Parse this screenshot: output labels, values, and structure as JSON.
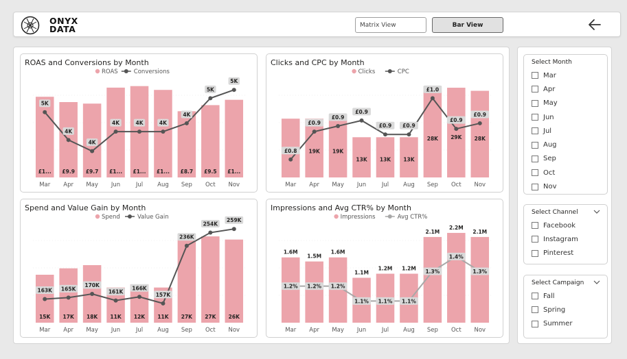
{
  "header": {
    "logo_line1": "ONYX",
    "logo_line2": "DATA",
    "matrix_view_label": "Matrix View",
    "bar_view_label": "Bar View",
    "back_icon": "arrow-left-icon"
  },
  "colors": {
    "bar": "#eca4ab",
    "line": "#555555",
    "line_light": "#a8a8a8",
    "label_bg": "#d9d9d9",
    "gridline": "#e6e6e6"
  },
  "chart_data": [
    {
      "type": "bar",
      "title": "ROAS and Conversions by Month",
      "categories": [
        "Mar",
        "Apr",
        "May",
        "Jun",
        "Jul",
        "Aug",
        "Sep",
        "Oct",
        "Nov"
      ],
      "series": [
        {
          "name": "ROAS",
          "kind": "bar",
          "values": [
            10.6,
            9.9,
            9.7,
            11.8,
            12.0,
            11.5,
            8.7,
            9.5,
            10.2
          ],
          "labels": [
            "£1...",
            "£9.9",
            "£9.7",
            "£1...",
            "£1...",
            "£1...",
            "£8.7",
            "£9.5",
            "£1..."
          ]
        },
        {
          "name": "Conversions",
          "kind": "line",
          "values": [
            4700,
            3700,
            3300,
            4000,
            4000,
            4000,
            4300,
            5200,
            5500
          ],
          "labels": [
            "5K",
            "4K",
            "4K",
            "4K",
            "4K",
            "4K",
            "4K",
            "5K",
            "5K"
          ]
        }
      ]
    },
    {
      "type": "bar",
      "title": "Clicks and CPC by Month",
      "categories": [
        "Mar",
        "Apr",
        "May",
        "Jun",
        "Jul",
        "Aug",
        "Sep",
        "Oct",
        "Nov"
      ],
      "series": [
        {
          "name": "Clicks",
          "kind": "bar",
          "values": [
            19000,
            19000,
            19000,
            13000,
            13000,
            13000,
            28000,
            29000,
            28000
          ],
          "labels": [
            "19K",
            "19K",
            "19K",
            "13K",
            "13K",
            "13K",
            "28K",
            "29K",
            "28K"
          ]
        },
        {
          "name": "CPC",
          "kind": "line",
          "values": [
            0.78,
            0.88,
            0.9,
            0.92,
            0.87,
            0.87,
            1.0,
            0.89,
            0.91
          ],
          "labels": [
            "£0.8",
            "£0.9",
            "£0.9",
            "£0.9",
            "£0.9",
            "£0.9",
            "£1.0",
            "£0.9",
            "£0.9"
          ]
        }
      ]
    },
    {
      "type": "bar",
      "title": "Spend and Value Gain by Month",
      "categories": [
        "Mar",
        "Apr",
        "May",
        "Jun",
        "Jul",
        "Aug",
        "Sep",
        "Oct",
        "Nov"
      ],
      "series": [
        {
          "name": "Spend",
          "kind": "bar",
          "values": [
            15000,
            17000,
            18000,
            11000,
            12000,
            11000,
            27000,
            27000,
            26000
          ],
          "labels": [
            "15K",
            "17K",
            "18K",
            "11K",
            "12K",
            "11K",
            "27K",
            "27K",
            "26K"
          ]
        },
        {
          "name": "Value Gain",
          "kind": "line",
          "values": [
            163000,
            165000,
            170000,
            161000,
            166000,
            157000,
            236000,
            254000,
            259000
          ],
          "labels": [
            "163K",
            "165K",
            "170K",
            "161K",
            "166K",
            "157K",
            "236K",
            "254K",
            "259K"
          ]
        }
      ]
    },
    {
      "type": "bar",
      "title": "Impressions and Avg CTR% by Month",
      "categories": [
        "Mar",
        "Apr",
        "May",
        "Jun",
        "Jul",
        "Aug",
        "Sep",
        "Oct",
        "Nov"
      ],
      "series": [
        {
          "name": "Impressions",
          "kind": "bar",
          "values": [
            1600000,
            1500000,
            1600000,
            1100000,
            1200000,
            1200000,
            2100000,
            2200000,
            2100000
          ],
          "labels": [
            "1.6M",
            "1.5M",
            "1.6M",
            "1.1M",
            "1.2M",
            "1.2M",
            "2.1M",
            "2.2M",
            "2.1M"
          ]
        },
        {
          "name": "Avg CTR%",
          "kind": "line",
          "values": [
            1.2,
            1.2,
            1.2,
            1.1,
            1.1,
            1.1,
            1.3,
            1.4,
            1.3
          ],
          "labels": [
            "1.2%",
            "1.2%",
            "1.2%",
            "1.1%",
            "1.1%",
            "1.1%",
            "1.3%",
            "1.4%",
            "1.3%"
          ]
        }
      ]
    }
  ],
  "slicers": {
    "month": {
      "title": "Select Month",
      "items": [
        "Mar",
        "Apr",
        "May",
        "Jun",
        "Jul",
        "Aug",
        "Sep",
        "Oct",
        "Nov"
      ]
    },
    "channel": {
      "title": "Select Channel",
      "items": [
        "Facebook",
        "Instagram",
        "Pinterest"
      ]
    },
    "campaign": {
      "title": "Select Campaign",
      "items": [
        "Fall",
        "Spring",
        "Summer"
      ]
    }
  }
}
